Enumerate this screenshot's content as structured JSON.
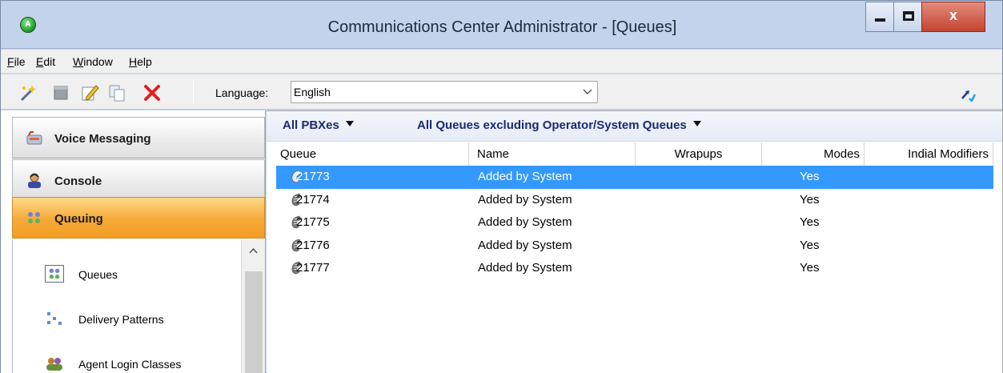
{
  "window": {
    "title": "Communications Center Administrator - [Queues]",
    "app_icon_letter": "A",
    "close_label": "x"
  },
  "menu": [
    {
      "mnemonic": "F",
      "rest": "ile"
    },
    {
      "mnemonic": "E",
      "rest": "dit"
    },
    {
      "mnemonic": "W",
      "rest": "indow"
    },
    {
      "mnemonic": "H",
      "rest": "elp"
    }
  ],
  "toolbar": {
    "icons": [
      "new-wizard-icon",
      "delete-icon",
      "edit-icon",
      "copy-icon",
      "remove-icon"
    ],
    "language_label": "Language:",
    "language_value": "English"
  },
  "nav": {
    "groups": [
      {
        "label": "Voice Messaging",
        "icon": "voice-messaging-icon"
      },
      {
        "label": "Console",
        "icon": "console-icon"
      },
      {
        "label": "Queuing",
        "icon": "queuing-icon",
        "active": true
      }
    ],
    "items": [
      {
        "label": "Queues",
        "icon": "queues-icon",
        "selected": true
      },
      {
        "label": "Delivery Patterns",
        "icon": "delivery-patterns-icon"
      },
      {
        "label": "Agent Login Classes",
        "icon": "agent-login-classes-icon"
      }
    ]
  },
  "filters": {
    "pbx": "All PBXes",
    "queues": "All Queues excluding Operator/System Queues"
  },
  "table": {
    "columns": [
      "Queue",
      "Name",
      "Wrapups",
      "Modes",
      "Indial Modifiers"
    ],
    "rows": [
      {
        "queue": "21773",
        "name": "Added by System",
        "wrapups": "",
        "modes": "Yes",
        "indial": "",
        "selected": true
      },
      {
        "queue": "21774",
        "name": "Added by System",
        "wrapups": "",
        "modes": "Yes",
        "indial": ""
      },
      {
        "queue": "21775",
        "name": "Added by System",
        "wrapups": "",
        "modes": "Yes",
        "indial": ""
      },
      {
        "queue": "21776",
        "name": "Added by System",
        "wrapups": "",
        "modes": "Yes",
        "indial": ""
      },
      {
        "queue": "21777",
        "name": "Added by System",
        "wrapups": "",
        "modes": "Yes",
        "indial": ""
      }
    ]
  },
  "colors": {
    "selection": "#3399ff",
    "active_group": "#f5a936",
    "filter_text": "#1a2a73"
  }
}
